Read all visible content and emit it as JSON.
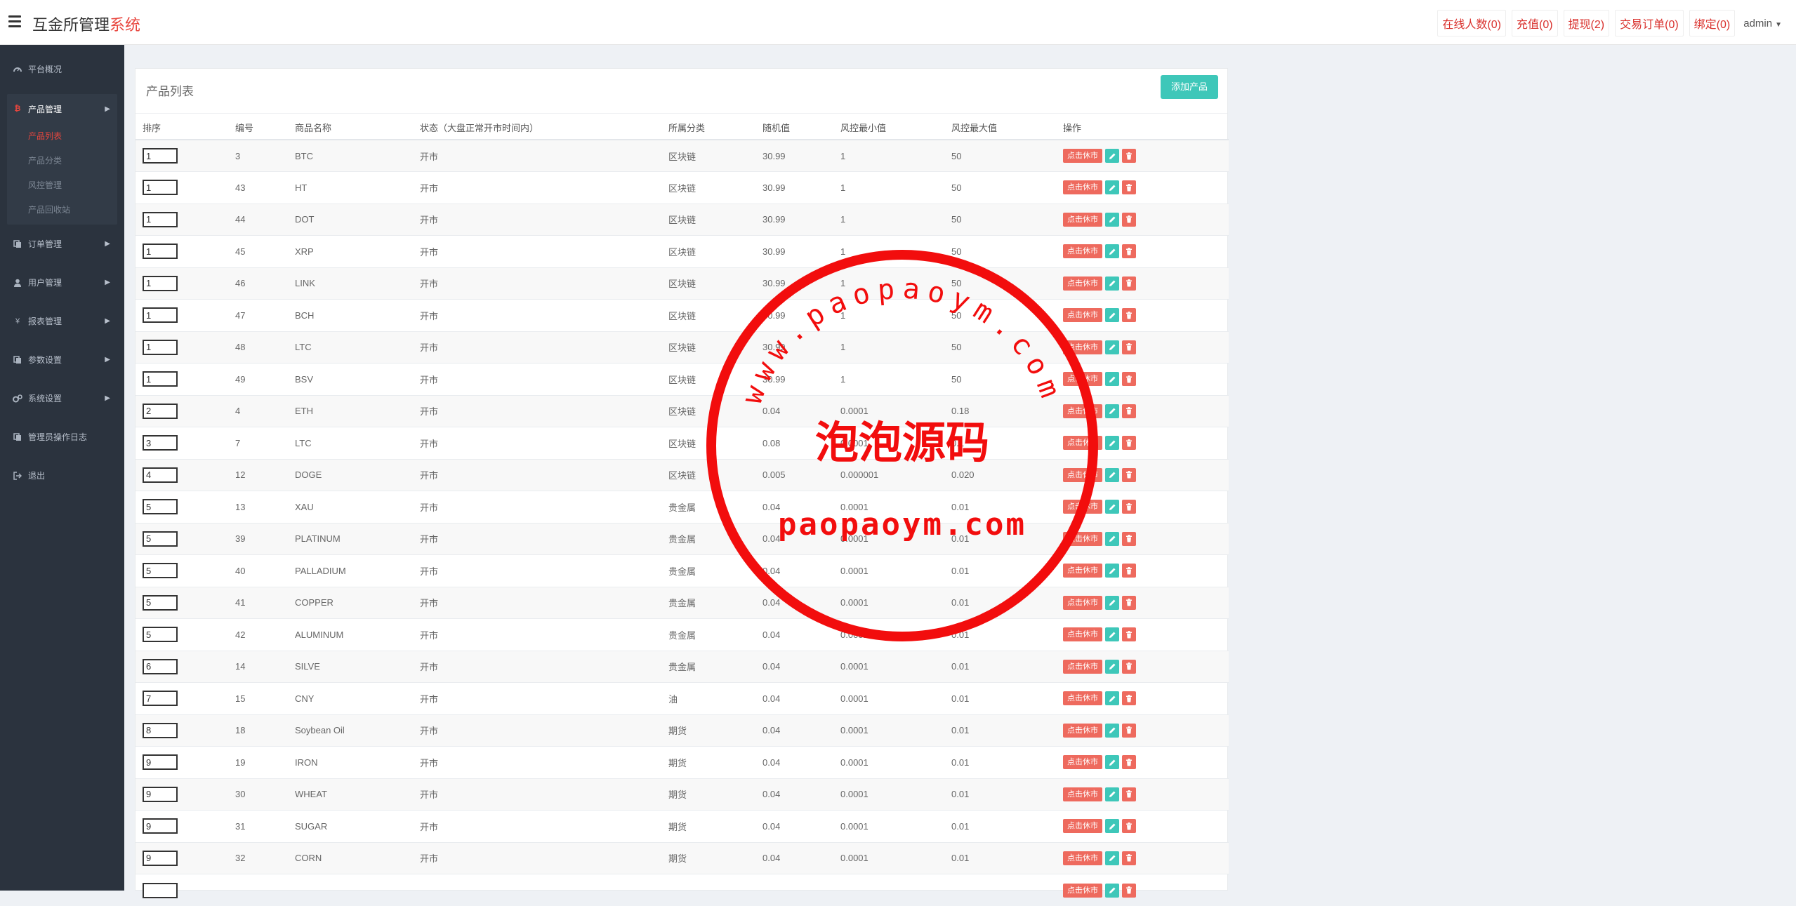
{
  "header": {
    "brand_main": "互金所管理",
    "brand_accent": "系统",
    "links": [
      {
        "label": "在线人数(0)"
      },
      {
        "label": "充值(0)"
      },
      {
        "label": "提现(2)"
      },
      {
        "label": "交易订单(0)"
      },
      {
        "label": "绑定(0)"
      }
    ],
    "user": "admin"
  },
  "sidebar": {
    "top": [
      {
        "label": "平台概况",
        "icon": "dashboard-icon"
      }
    ],
    "group": {
      "label": "产品管理",
      "icon": "bitcoin-icon",
      "sub": [
        {
          "label": "产品列表",
          "active": true
        },
        {
          "label": "产品分类"
        },
        {
          "label": "风控管理"
        },
        {
          "label": "产品回收站"
        }
      ]
    },
    "items": [
      {
        "label": "订单管理",
        "icon": "copy-icon",
        "arrow": true
      },
      {
        "label": "用户管理",
        "icon": "user-icon",
        "arrow": true
      },
      {
        "label": "报表管理",
        "icon": "yen-icon",
        "arrow": true
      },
      {
        "label": "参数设置",
        "icon": "copy-icon",
        "arrow": true
      },
      {
        "label": "系统设置",
        "icon": "gears-icon",
        "arrow": true
      },
      {
        "label": "管理员操作日志",
        "icon": "copy-icon",
        "arrow": false
      },
      {
        "label": "退出",
        "icon": "sign-out-icon",
        "arrow": false
      }
    ]
  },
  "panel": {
    "title": "产品列表",
    "add_button": "添加产品"
  },
  "table": {
    "headers": [
      "排序",
      "编号",
      "商品名称",
      "状态（大盘正常开市时间内）",
      "所属分类",
      "随机值",
      "风控最小值",
      "风控最大值",
      "操作"
    ],
    "action_label": "点击休市",
    "rows": [
      {
        "sort": "1",
        "id": "3",
        "name": "BTC",
        "status": "开市",
        "category": "区块链",
        "random": "30.99",
        "min": "1",
        "max": "50"
      },
      {
        "sort": "1",
        "id": "43",
        "name": "HT",
        "status": "开市",
        "category": "区块链",
        "random": "30.99",
        "min": "1",
        "max": "50"
      },
      {
        "sort": "1",
        "id": "44",
        "name": "DOT",
        "status": "开市",
        "category": "区块链",
        "random": "30.99",
        "min": "1",
        "max": "50"
      },
      {
        "sort": "1",
        "id": "45",
        "name": "XRP",
        "status": "开市",
        "category": "区块链",
        "random": "30.99",
        "min": "1",
        "max": "50"
      },
      {
        "sort": "1",
        "id": "46",
        "name": "LINK",
        "status": "开市",
        "category": "区块链",
        "random": "30.99",
        "min": "1",
        "max": "50"
      },
      {
        "sort": "1",
        "id": "47",
        "name": "BCH",
        "status": "开市",
        "category": "区块链",
        "random": "30.99",
        "min": "1",
        "max": "50"
      },
      {
        "sort": "1",
        "id": "48",
        "name": "LTC",
        "status": "开市",
        "category": "区块链",
        "random": "30.99",
        "min": "1",
        "max": "50"
      },
      {
        "sort": "1",
        "id": "49",
        "name": "BSV",
        "status": "开市",
        "category": "区块链",
        "random": "30.99",
        "min": "1",
        "max": "50"
      },
      {
        "sort": "2",
        "id": "4",
        "name": "ETH",
        "status": "开市",
        "category": "区块链",
        "random": "0.04",
        "min": "0.0001",
        "max": "0.18"
      },
      {
        "sort": "3",
        "id": "7",
        "name": "LTC",
        "status": "开市",
        "category": "区块链",
        "random": "0.08",
        "min": "0.0001",
        "max": "0.1"
      },
      {
        "sort": "4",
        "id": "12",
        "name": "DOGE",
        "status": "开市",
        "category": "区块链",
        "random": "0.005",
        "min": "0.000001",
        "max": "0.020"
      },
      {
        "sort": "5",
        "id": "13",
        "name": "XAU",
        "status": "开市",
        "category": "贵金属",
        "random": "0.04",
        "min": "0.0001",
        "max": "0.01"
      },
      {
        "sort": "5",
        "id": "39",
        "name": "PLATINUM",
        "status": "开市",
        "category": "贵金属",
        "random": "0.04",
        "min": "0.0001",
        "max": "0.01"
      },
      {
        "sort": "5",
        "id": "40",
        "name": "PALLADIUM",
        "status": "开市",
        "category": "贵金属",
        "random": "0.04",
        "min": "0.0001",
        "max": "0.01"
      },
      {
        "sort": "5",
        "id": "41",
        "name": "COPPER",
        "status": "开市",
        "category": "贵金属",
        "random": "0.04",
        "min": "0.0001",
        "max": "0.01"
      },
      {
        "sort": "5",
        "id": "42",
        "name": "ALUMINUM",
        "status": "开市",
        "category": "贵金属",
        "random": "0.04",
        "min": "0.0001",
        "max": "0.01"
      },
      {
        "sort": "6",
        "id": "14",
        "name": "SILVE",
        "status": "开市",
        "category": "贵金属",
        "random": "0.04",
        "min": "0.0001",
        "max": "0.01"
      },
      {
        "sort": "7",
        "id": "15",
        "name": "CNY",
        "status": "开市",
        "category": "油",
        "random": "0.04",
        "min": "0.0001",
        "max": "0.01"
      },
      {
        "sort": "8",
        "id": "18",
        "name": "Soybean Oil",
        "status": "开市",
        "category": "期货",
        "random": "0.04",
        "min": "0.0001",
        "max": "0.01"
      },
      {
        "sort": "9",
        "id": "19",
        "name": "IRON",
        "status": "开市",
        "category": "期货",
        "random": "0.04",
        "min": "0.0001",
        "max": "0.01"
      },
      {
        "sort": "9",
        "id": "30",
        "name": "WHEAT",
        "status": "开市",
        "category": "期货",
        "random": "0.04",
        "min": "0.0001",
        "max": "0.01"
      },
      {
        "sort": "9",
        "id": "31",
        "name": "SUGAR",
        "status": "开市",
        "category": "期货",
        "random": "0.04",
        "min": "0.0001",
        "max": "0.01"
      },
      {
        "sort": "9",
        "id": "32",
        "name": "CORN",
        "status": "开市",
        "category": "期货",
        "random": "0.04",
        "min": "0.0001",
        "max": "0.01"
      },
      {
        "sort": "",
        "id": "",
        "name": "",
        "status": "",
        "category": "",
        "random": "",
        "min": "",
        "max": ""
      }
    ]
  },
  "watermark": {
    "arc_text": "www.paopaoym.com",
    "center_text": "泡泡源码",
    "bottom_text": "paopaoym.com"
  },
  "colors": {
    "accent_red": "#e8463e",
    "teal": "#3ec7b9",
    "sidebar_bg": "#2b333e"
  }
}
